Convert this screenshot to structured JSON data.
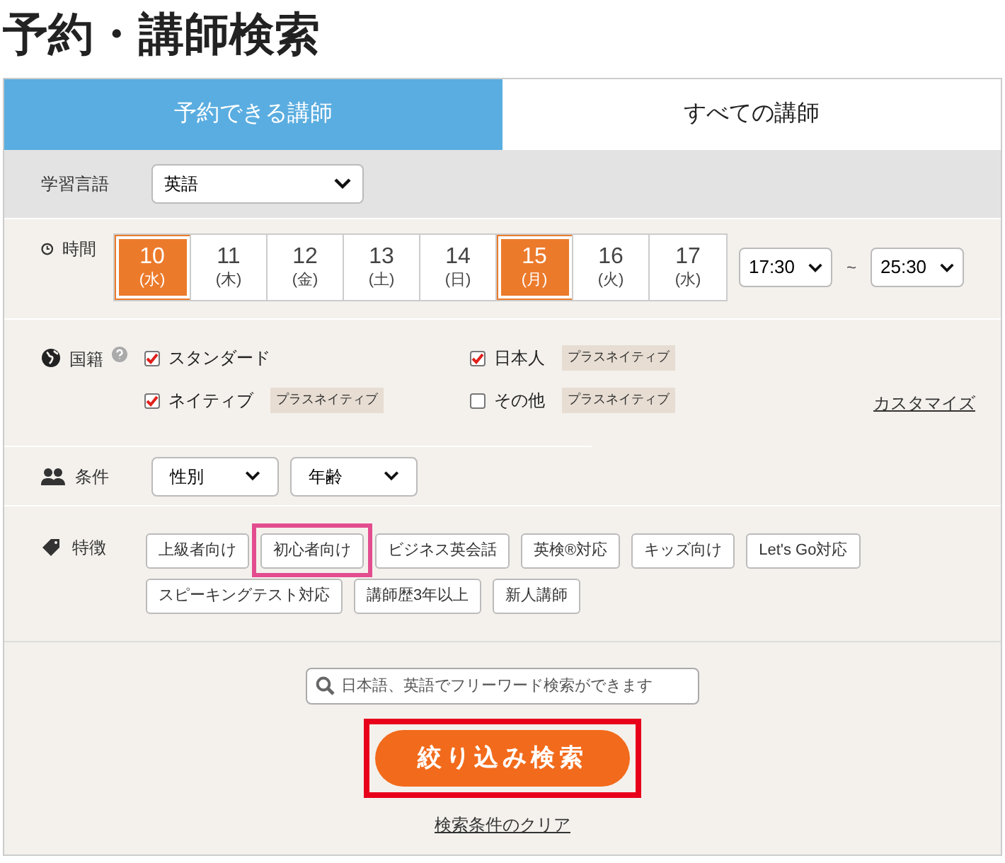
{
  "title": "予約・講師検索",
  "tabs": [
    {
      "label": "予約できる講師",
      "selected": true
    },
    {
      "label": "すべての講師",
      "selected": false
    }
  ],
  "language": {
    "label": "学習言語",
    "value": "英語"
  },
  "time": {
    "label": "時間",
    "days": [
      {
        "date": "10",
        "weekday": "(水)",
        "selected": true
      },
      {
        "date": "11",
        "weekday": "(木)",
        "selected": false
      },
      {
        "date": "12",
        "weekday": "(金)",
        "selected": false
      },
      {
        "date": "13",
        "weekday": "(土)",
        "selected": false
      },
      {
        "date": "14",
        "weekday": "(日)",
        "selected": false
      },
      {
        "date": "15",
        "weekday": "(月)",
        "selected": true
      },
      {
        "date": "16",
        "weekday": "(火)",
        "selected": false
      },
      {
        "date": "17",
        "weekday": "(水)",
        "selected": false
      }
    ],
    "from": "17:30",
    "separator": "~",
    "to": "25:30"
  },
  "nationality": {
    "label": "国籍",
    "options": [
      {
        "label": "スタンダード",
        "checked": true
      },
      {
        "label": "日本人",
        "checked": true,
        "tag": "プラスネイティブ"
      },
      {
        "label": "ネイティブ",
        "checked": true,
        "tag": "プラスネイティブ"
      },
      {
        "label": "その他",
        "checked": false,
        "tag": "プラスネイティブ"
      }
    ],
    "customize": "カスタマイズ"
  },
  "conditions": {
    "label": "条件",
    "selects": [
      "性別",
      "年齢"
    ]
  },
  "features": {
    "label": "特徴",
    "tags": [
      {
        "label": "上級者向け",
        "highlighted": false
      },
      {
        "label": "初心者向け",
        "highlighted": true
      },
      {
        "label": "ビジネス英会話",
        "highlighted": false
      },
      {
        "label": "英検®対応",
        "highlighted": false
      },
      {
        "label": "キッズ向け",
        "highlighted": false
      },
      {
        "label": "Let's Go対応",
        "highlighted": false
      },
      {
        "label": "スピーキングテスト対応",
        "highlighted": false
      },
      {
        "label": "講師歴3年以上",
        "highlighted": false
      },
      {
        "label": "新人講師",
        "highlighted": false
      }
    ]
  },
  "search": {
    "placeholder": "日本語、英語でフリーワード検索ができます"
  },
  "submit": {
    "label": "絞り込み検索",
    "highlighted": true
  },
  "clear": "検索条件のクリア"
}
